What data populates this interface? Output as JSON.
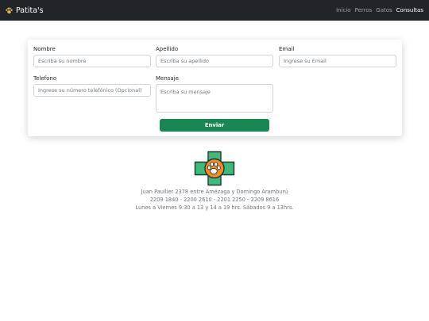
{
  "navbar": {
    "brand": "Patita's",
    "links": [
      {
        "label": "Inicio"
      },
      {
        "label": "Perros"
      },
      {
        "label": "Gatos"
      },
      {
        "label": "Consultas",
        "active": true
      }
    ]
  },
  "form": {
    "nombre": {
      "label": "Nombre",
      "placeholder": "Escriba su nombre",
      "value": ""
    },
    "apellido": {
      "label": "Apellido",
      "placeholder": "Escriba su apellido",
      "value": ""
    },
    "email": {
      "label": "Email",
      "placeholder": "Ingrese su Email",
      "value": ""
    },
    "telefono": {
      "label": "Telefono",
      "placeholder": "Ingrese su número telefónico (Opcional)",
      "value": ""
    },
    "mensaje": {
      "label": "Mensaje",
      "placeholder": "Escriba su mensaje",
      "value": ""
    },
    "submit_label": "Enviar"
  },
  "footer": {
    "address": "Juan Paullier 2378 entre Amézaga y Domingo Aramburú",
    "phones": "2209 1840 - 2200 2610 - 2201 2250 - 2209 8616",
    "hours": "Lunes a Viernes 9:30 a 13 y 14 a 19 hrs. Sábados 9 a 13hrs."
  },
  "colors": {
    "navbar": "#212529",
    "button": "#198754",
    "cross": "#3dbb7a",
    "paw_circle": "#f5892b"
  },
  "icons": {
    "brand_logo": "paw-icon",
    "footer_logo": "vet-cross-paw-icon"
  }
}
